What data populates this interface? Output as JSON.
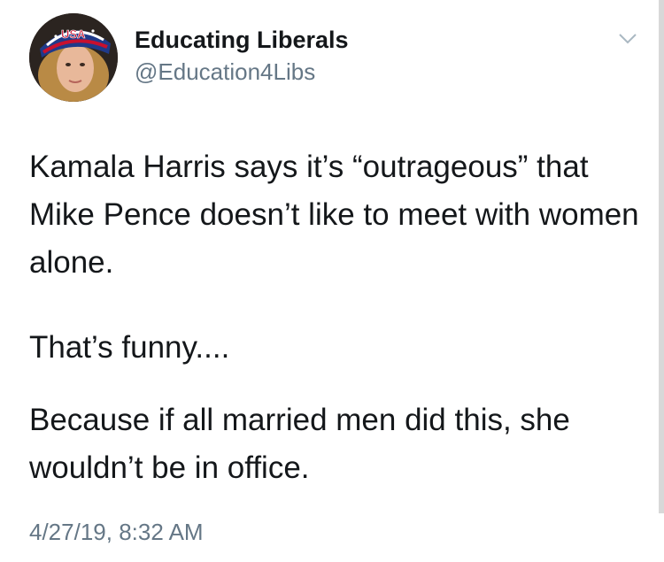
{
  "tweet": {
    "display_name": "Educating Liberals",
    "handle": "@Education4Libs",
    "avatar_icon": "profile-photo-man-usa-cap",
    "cap_text": "USA",
    "menu_icon": "chevron-down-icon",
    "paragraphs": [
      "Kamala Harris says it’s “outrageous” that Mike Pence doesn’t like to meet with women alone.",
      "That’s funny....",
      "Because if all married men did this, she wouldn’t be in office."
    ],
    "timestamp": "4/27/19, 8:32 AM"
  },
  "colors": {
    "text": "#14171a",
    "secondary": "#657786",
    "background": "#ffffff"
  }
}
